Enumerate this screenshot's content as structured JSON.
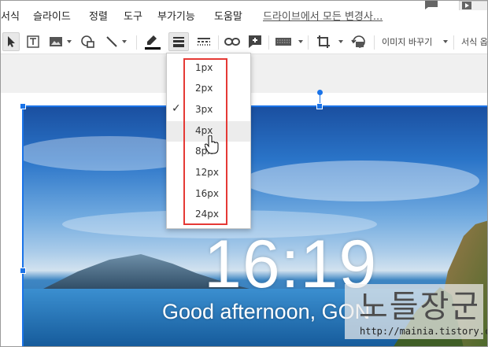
{
  "menu": {
    "items": [
      "서식",
      "슬라이드",
      "정렬",
      "도구",
      "부가기능",
      "도움말"
    ],
    "drive_link": "드라이브에서 모든 변경사..."
  },
  "toolbar": {
    "replace_image_label": "이미지 바꾸기",
    "format_options_label": "서식 옵"
  },
  "dropdown": {
    "items": [
      "1px",
      "2px",
      "3px",
      "4px",
      "8px",
      "12px",
      "16px",
      "24px"
    ],
    "selected": "3px",
    "hovered": "4px"
  },
  "slide": {
    "clock": "16:19",
    "greeting": "Good afternoon, GON",
    "watermark_url": "http://mainia.tistory.com"
  },
  "colors": {
    "accent": "#1a73e8",
    "highlight_box": "#e53935"
  }
}
